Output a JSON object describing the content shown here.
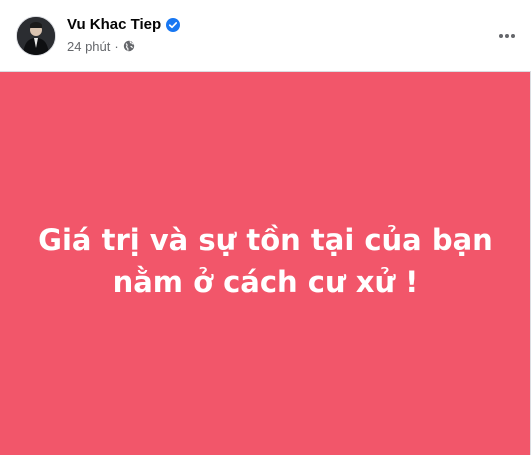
{
  "author": {
    "name": "Vu Khac Tiep",
    "verified": true,
    "avatar_icon": "user-avatar"
  },
  "meta": {
    "time": "24 phút",
    "separator": "·",
    "audience_icon": "globe-icon"
  },
  "actions": {
    "more_icon": "more-horizontal-icon"
  },
  "post": {
    "background_color": "#f2566a",
    "text_color": "#ffffff",
    "lines": [
      "Giá trị và sự tồn tại của bạn",
      "nằm ở cách cư xử !"
    ]
  },
  "colors": {
    "verified_badge": "#1877f2",
    "meta_text": "#65676b",
    "name_text": "#050505"
  }
}
